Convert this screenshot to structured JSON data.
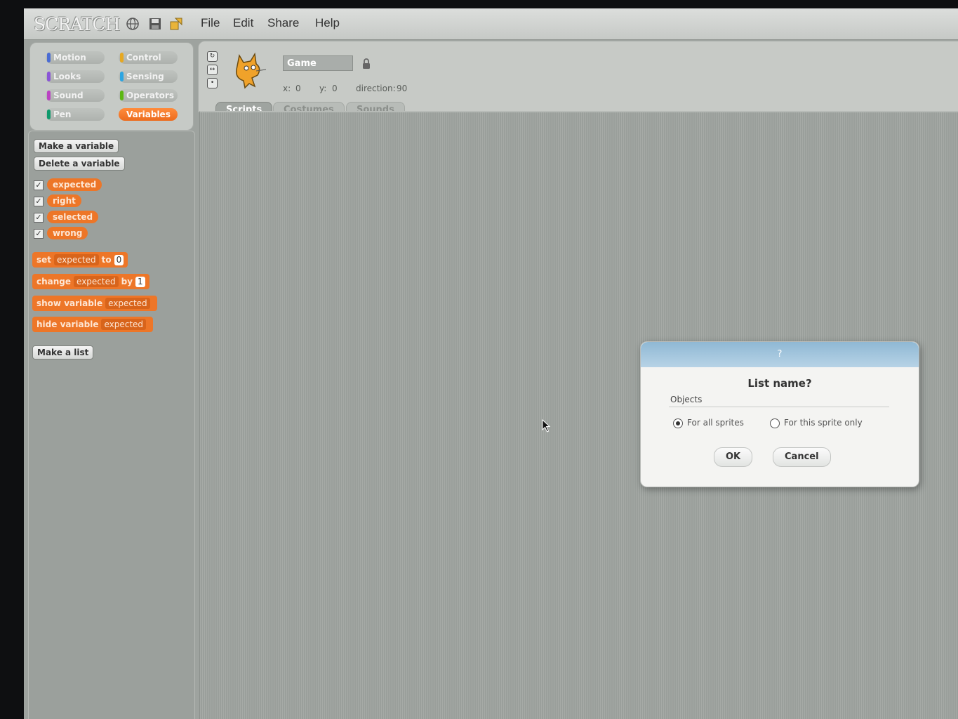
{
  "menubar": {
    "logo": "SCRATCH",
    "menus": [
      "File",
      "Edit",
      "Share",
      "Help"
    ]
  },
  "categories": [
    {
      "label": "Motion",
      "color": "#4a6cd4"
    },
    {
      "label": "Control",
      "color": "#e6a822"
    },
    {
      "label": "Looks",
      "color": "#8a55d7"
    },
    {
      "label": "Sensing",
      "color": "#2ca5e2"
    },
    {
      "label": "Sound",
      "color": "#bb42c3"
    },
    {
      "label": "Operators",
      "color": "#5cb712"
    },
    {
      "label": "Pen",
      "color": "#0e9a6c"
    },
    {
      "label": "Variables",
      "color": "#ee7d16"
    }
  ],
  "palette": {
    "make_variable": "Make a variable",
    "delete_variable": "Delete a variable",
    "variables": [
      "expected",
      "right",
      "selected",
      "wrong"
    ],
    "check_mark": "✓",
    "set_block": {
      "word1": "set",
      "var": "expected",
      "word2": "to",
      "value": "0"
    },
    "change_block": {
      "word1": "change",
      "var": "expected",
      "word2": "by",
      "value": "1"
    },
    "show_block": {
      "word1": "show variable",
      "var": "expected"
    },
    "hide_block": {
      "word1": "hide variable",
      "var": "expected"
    },
    "make_list": "Make a list"
  },
  "sprite": {
    "name": "Game",
    "x_label": "x:",
    "x_value": "0",
    "y_label": "y:",
    "y_value": "0",
    "direction_label": "direction:",
    "direction_value": "90"
  },
  "tabs": [
    "Scripts",
    "Costumes",
    "Sounds"
  ],
  "dialog": {
    "title": "?",
    "question": "List name?",
    "input_value": "Objects",
    "radio_all": "For all sprites",
    "radio_this": "For this sprite only",
    "ok": "OK",
    "cancel": "Cancel"
  }
}
